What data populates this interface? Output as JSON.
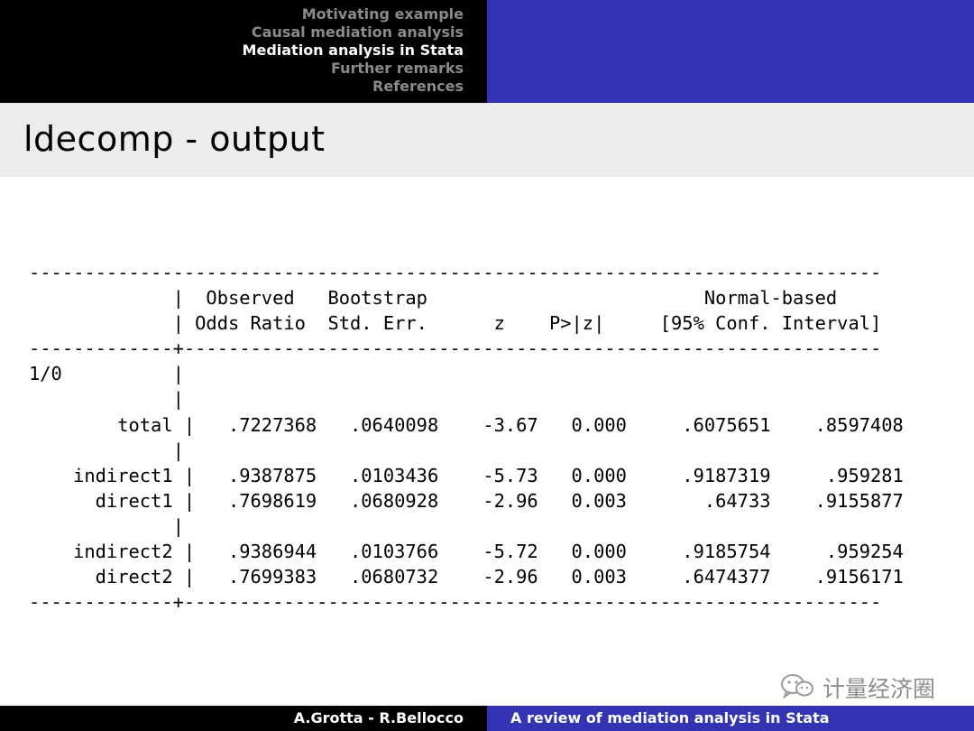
{
  "header": {
    "nav_items": [
      "Motivating example",
      "Causal mediation analysis",
      "Mediation analysis in Stata",
      "Further remarks",
      "References"
    ],
    "active_index": 2
  },
  "frame_title": "ldecomp - output",
  "output_lines": [
    "-----------------------------------------------------------------------------",
    "             |  Observed   Bootstrap                         Normal-based",
    "             | Odds Ratio  Std. Err.      z    P>|z|     [95% Conf. Interval]",
    "-------------+---------------------------------------------------------------",
    "1/0          |",
    "             |",
    "        total |   .7227368   .0640098    -3.67   0.000     .6075651    .8597408",
    "             |",
    "    indirect1 |   .9387875   .0103436    -5.73   0.000     .9187319     .959281",
    "      direct1 |   .7698619   .0680928    -2.96   0.003       .64733    .9155877",
    "             |",
    "    indirect2 |   .9386944   .0103766    -5.72   0.000     .9185754     .959254",
    "      direct2 |   .7699383   .0680732    -2.96   0.003     .6474377    .9156171",
    "-------------+---------------------------------------------------------------"
  ],
  "watermark": {
    "text": "计量经济圈",
    "icon": "wechat-icon"
  },
  "footer": {
    "authors": "A.Grotta - R.Bellocco",
    "title": "A review of mediation analysis in Stata"
  },
  "colors": {
    "header_dark": "#000000",
    "header_blue": "#3333b3",
    "title_bar": "#ececec",
    "nav_inactive": "#8a8a8a",
    "nav_active": "#ffffff"
  }
}
